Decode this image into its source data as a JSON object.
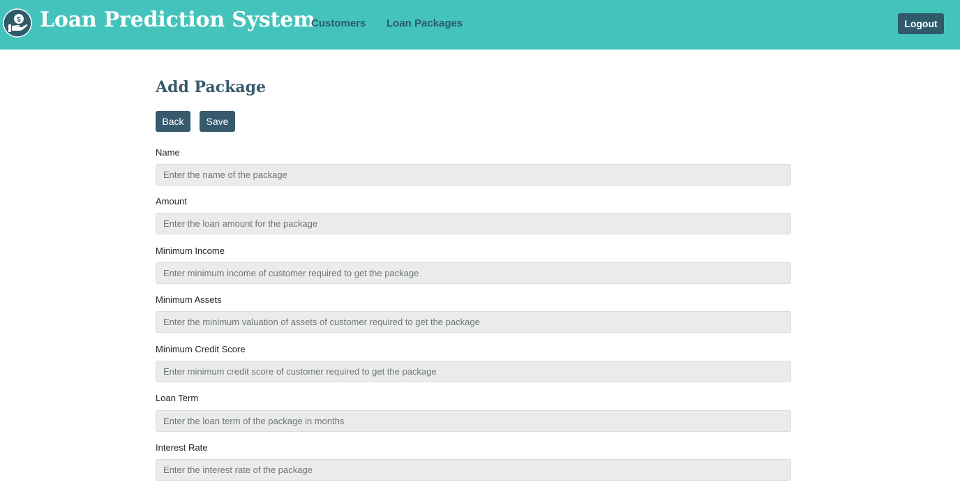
{
  "brand": {
    "title": "Loan Prediction System",
    "logo_icon": "hand-money-icon"
  },
  "nav": {
    "items": [
      {
        "label": "Customers"
      },
      {
        "label": "Loan Packages"
      }
    ],
    "logout_label": "Logout"
  },
  "page": {
    "title": "Add Package",
    "back_label": "Back",
    "save_label": "Save"
  },
  "form": {
    "fields": [
      {
        "label": "Name",
        "value": "",
        "placeholder": "Enter the name of the package"
      },
      {
        "label": "Amount",
        "value": "",
        "placeholder": "Enter the loan amount for the package"
      },
      {
        "label": "Minimum Income",
        "value": "",
        "placeholder": "Enter minimum income of customer required to get the package"
      },
      {
        "label": "Minimum Assets",
        "value": "",
        "placeholder": "Enter the minimum valuation of assets of customer required to get the package"
      },
      {
        "label": "Minimum Credit Score",
        "value": "",
        "placeholder": "Enter minimum credit score of customer required to get the package"
      },
      {
        "label": "Loan Term",
        "value": "",
        "placeholder": "Enter the loan term of the package in months"
      },
      {
        "label": "Interest Rate",
        "value": "",
        "placeholder": "Enter the interest rate of the package"
      }
    ]
  },
  "colors": {
    "navbar": "#43c3bb",
    "nav_link": "#2b5b6b",
    "primary_button": "#375a6d",
    "input_background": "#ebecea"
  }
}
